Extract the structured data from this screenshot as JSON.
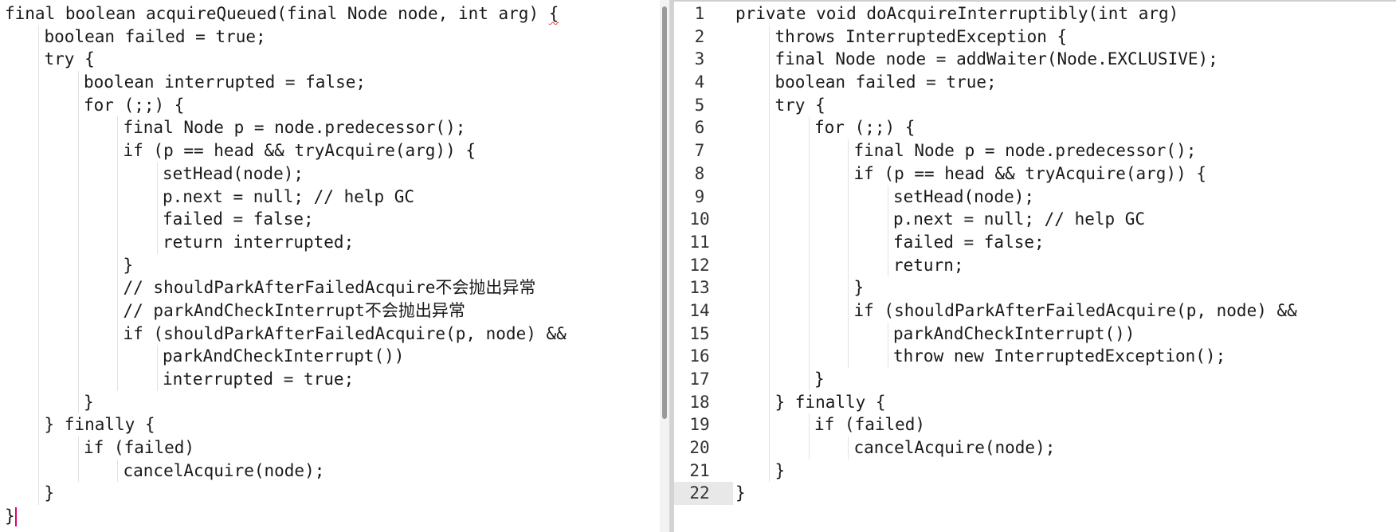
{
  "left_editor": {
    "lines": [
      {
        "indent": 0,
        "text": "final boolean acquireQueued(final Node node, int arg) {"
      },
      {
        "indent": 1,
        "text": "boolean failed = true;"
      },
      {
        "indent": 1,
        "text": "try {"
      },
      {
        "indent": 2,
        "text": "boolean interrupted = false;"
      },
      {
        "indent": 2,
        "text": "for (;;) {"
      },
      {
        "indent": 3,
        "text": "final Node p = node.predecessor();"
      },
      {
        "indent": 3,
        "text": "if (p == head && tryAcquire(arg)) {"
      },
      {
        "indent": 4,
        "text": "setHead(node);"
      },
      {
        "indent": 4,
        "text": "p.next = null; // help GC"
      },
      {
        "indent": 4,
        "text": "failed = false;"
      },
      {
        "indent": 4,
        "text": "return interrupted;"
      },
      {
        "indent": 3,
        "text": "}"
      },
      {
        "indent": 3,
        "text": "// shouldParkAfterFailedAcquire不会抛出异常"
      },
      {
        "indent": 3,
        "text": "// parkAndCheckInterrupt不会抛出异常"
      },
      {
        "indent": 3,
        "text": "if (shouldParkAfterFailedAcquire(p, node) &&"
      },
      {
        "indent": 4,
        "text": "parkAndCheckInterrupt())"
      },
      {
        "indent": 4,
        "text": "interrupted = true;"
      },
      {
        "indent": 2,
        "text": "}"
      },
      {
        "indent": 1,
        "text": "} finally {"
      },
      {
        "indent": 2,
        "text": "if (failed)"
      },
      {
        "indent": 3,
        "text": "cancelAcquire(node);"
      },
      {
        "indent": 1,
        "text": "}"
      },
      {
        "indent": 0,
        "text": "}"
      }
    ]
  },
  "right_editor": {
    "current_line": 22,
    "lines": [
      {
        "number": "1",
        "indent": 0,
        "text": "private void doAcquireInterruptibly(int arg)"
      },
      {
        "number": "2",
        "indent": 1,
        "text": "throws InterruptedException {"
      },
      {
        "number": "3",
        "indent": 1,
        "text": "final Node node = addWaiter(Node.EXCLUSIVE);"
      },
      {
        "number": "4",
        "indent": 1,
        "text": "boolean failed = true;"
      },
      {
        "number": "5",
        "indent": 1,
        "text": "try {"
      },
      {
        "number": "6",
        "indent": 2,
        "text": "for (;;) {"
      },
      {
        "number": "7",
        "indent": 3,
        "text": "final Node p = node.predecessor();"
      },
      {
        "number": "8",
        "indent": 3,
        "text": "if (p == head && tryAcquire(arg)) {"
      },
      {
        "number": "9",
        "indent": 4,
        "text": "setHead(node);"
      },
      {
        "number": "10",
        "indent": 4,
        "text": "p.next = null; // help GC"
      },
      {
        "number": "11",
        "indent": 4,
        "text": "failed = false;"
      },
      {
        "number": "12",
        "indent": 4,
        "text": "return;"
      },
      {
        "number": "13",
        "indent": 3,
        "text": "}"
      },
      {
        "number": "14",
        "indent": 3,
        "text": "if (shouldParkAfterFailedAcquire(p, node) &&"
      },
      {
        "number": "15",
        "indent": 4,
        "text": "parkAndCheckInterrupt())"
      },
      {
        "number": "16",
        "indent": 4,
        "text": "throw new InterruptedException();"
      },
      {
        "number": "17",
        "indent": 2,
        "text": "}"
      },
      {
        "number": "18",
        "indent": 1,
        "text": "} finally {"
      },
      {
        "number": "19",
        "indent": 2,
        "text": "if (failed)"
      },
      {
        "number": "20",
        "indent": 3,
        "text": "cancelAcquire(node);"
      },
      {
        "number": "21",
        "indent": 1,
        "text": "}"
      },
      {
        "number": "22",
        "indent": 0,
        "text": "}"
      }
    ]
  },
  "colors": {
    "caret": "#e0006e",
    "current_line_highlight": "#e8e8e8",
    "indent_guide": "#e2e2e2",
    "spellcheck_underline": "#e34545"
  }
}
